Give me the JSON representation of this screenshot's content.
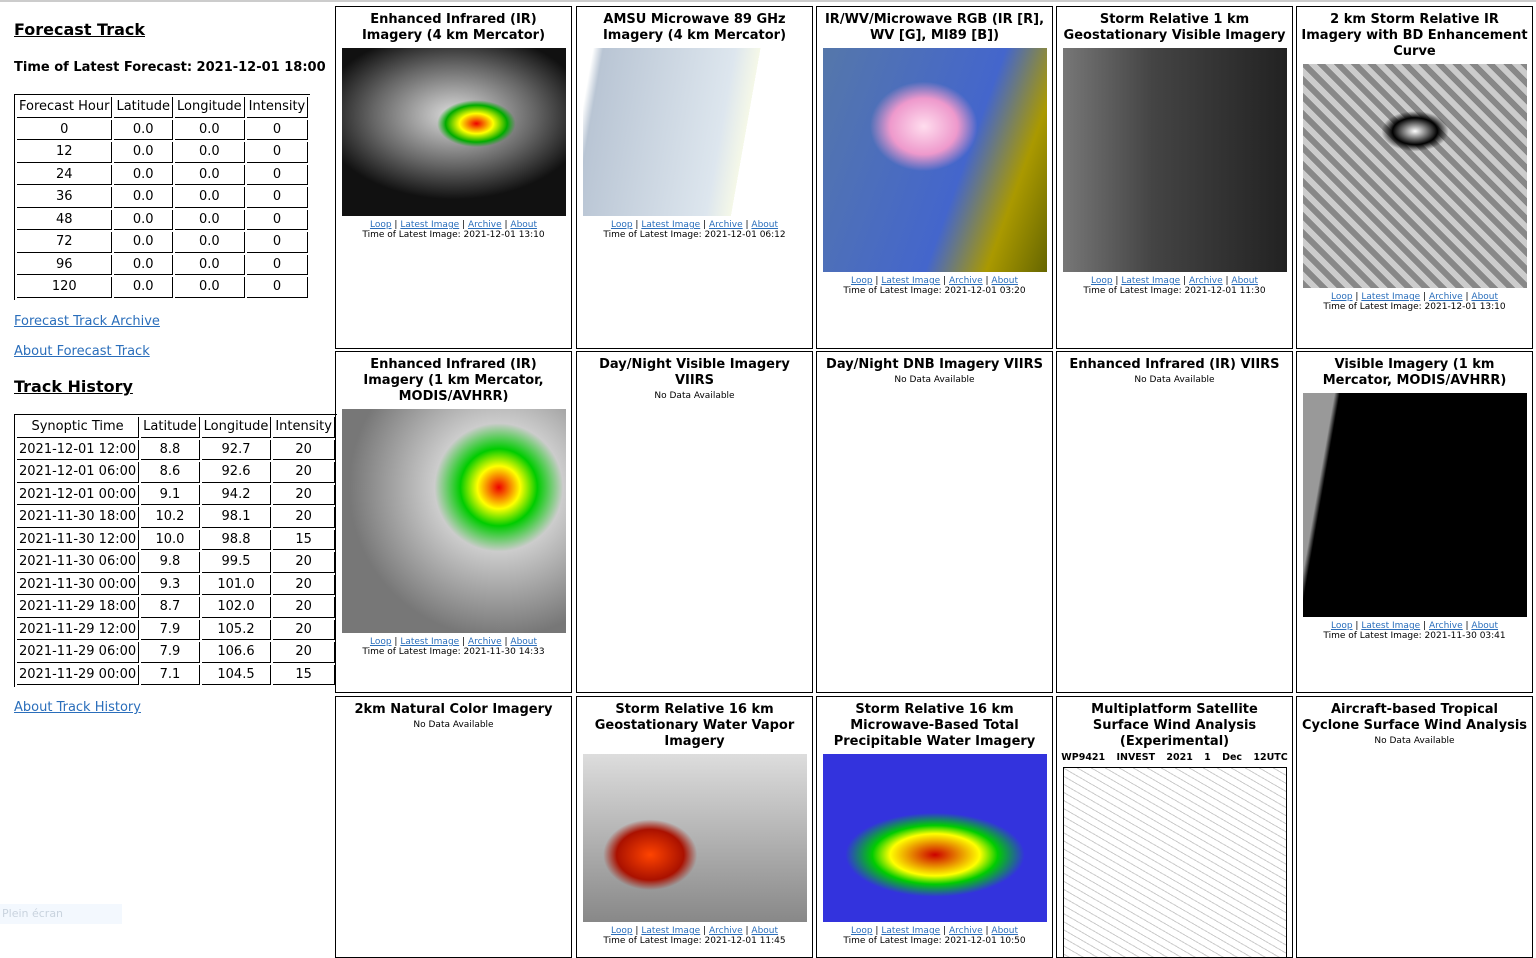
{
  "forecast": {
    "title": "Forecast Track",
    "latest": "Time of Latest Forecast: 2021-12-01 18:00",
    "headers": [
      "Forecast Hour",
      "Latitude",
      "Longitude",
      "Intensity"
    ],
    "rows": [
      [
        "0",
        "0.0",
        "0.0",
        "0"
      ],
      [
        "12",
        "0.0",
        "0.0",
        "0"
      ],
      [
        "24",
        "0.0",
        "0.0",
        "0"
      ],
      [
        "36",
        "0.0",
        "0.0",
        "0"
      ],
      [
        "48",
        "0.0",
        "0.0",
        "0"
      ],
      [
        "72",
        "0.0",
        "0.0",
        "0"
      ],
      [
        "96",
        "0.0",
        "0.0",
        "0"
      ],
      [
        "120",
        "0.0",
        "0.0",
        "0"
      ]
    ],
    "archive_link": "Forecast Track Archive",
    "about_link": "About Forecast Track"
  },
  "history": {
    "title": "Track History",
    "headers": [
      "Synoptic Time",
      "Latitude",
      "Longitude",
      "Intensity"
    ],
    "rows": [
      [
        "2021-12-01 12:00",
        "8.8",
        "92.7",
        "20"
      ],
      [
        "2021-12-01 06:00",
        "8.6",
        "92.6",
        "20"
      ],
      [
        "2021-12-01 00:00",
        "9.1",
        "94.2",
        "20"
      ],
      [
        "2021-11-30 18:00",
        "10.2",
        "98.1",
        "20"
      ],
      [
        "2021-11-30 12:00",
        "10.0",
        "98.8",
        "15"
      ],
      [
        "2021-11-30 06:00",
        "9.8",
        "99.5",
        "20"
      ],
      [
        "2021-11-30 00:00",
        "9.3",
        "101.0",
        "20"
      ],
      [
        "2021-11-29 18:00",
        "8.7",
        "102.0",
        "20"
      ],
      [
        "2021-11-29 12:00",
        "7.9",
        "105.2",
        "20"
      ],
      [
        "2021-11-29 06:00",
        "7.9",
        "106.6",
        "20"
      ],
      [
        "2021-11-29 00:00",
        "7.1",
        "104.5",
        "15"
      ]
    ],
    "about_link": "About Track History"
  },
  "fullscreen": "Plein écran",
  "link_labels": [
    "Loop",
    "Latest Image",
    "Archive",
    "About"
  ],
  "no_data": "No Data Available",
  "panels": [
    {
      "title": "Enhanced Infrared (IR) Imagery (4 km Mercator)",
      "time": "Time of Latest Image: 2021-12-01 13:10",
      "img": "ir4",
      "h": 168
    },
    {
      "title": "AMSU Microwave 89 GHz Imagery (4 km Mercator)",
      "time": "Time of Latest Image: 2021-12-01 06:12",
      "img": "amsu",
      "h": 168
    },
    {
      "title": "IR/WV/Microwave RGB (IR [R], WV [G], MI89 [B])",
      "time": "Time of Latest Image: 2021-12-01 03:20",
      "img": "rgb",
      "h": 224
    },
    {
      "title": "Storm Relative 1 km Geostationary Visible Imagery",
      "time": "Time of Latest Image: 2021-12-01 11:30",
      "img": "vis",
      "h": 224
    },
    {
      "title": "2 km Storm Relative IR Imagery with BD Enhancement Curve",
      "time": "Time of Latest Image: 2021-12-01 13:10",
      "img": "bd",
      "h": 224
    },
    {
      "title": "Enhanced Infrared (IR) Imagery (1 km Mercator, MODIS/AVHRR)",
      "time": "Time of Latest Image: 2021-11-30 14:33",
      "img": "ir1",
      "h": 224
    },
    {
      "title": "Day/Night Visible Imagery VIIRS",
      "time": null
    },
    {
      "title": "Day/Night DNB Imagery VIIRS",
      "time": null
    },
    {
      "title": "Enhanced Infrared (IR) VIIRS",
      "time": null
    },
    {
      "title": "Visible Imagery (1 km Mercator, MODIS/AVHRR)",
      "time": "Time of Latest Image: 2021-11-30 03:41",
      "img": "vis1",
      "h": 224
    },
    {
      "title": "2km Natural Color Imagery",
      "time": null
    },
    {
      "title": "Storm Relative 16 km Geostationary Water Vapor Imagery",
      "time": "Time of Latest Image: 2021-12-01 11:45",
      "img": "wv",
      "h": 168
    },
    {
      "title": "Storm Relative 16 km Microwave-Based Total Precipitable Water Imagery",
      "time": "Time of Latest Image: 2021-12-01 10:50",
      "img": "tpw",
      "h": 168
    },
    {
      "title": "Multiplatform Satellite Surface Wind Analysis (Experimental)",
      "subtitle": "WP9421 INVEST 2021 1 Dec 12UTC",
      "wind": true,
      "img": "wind",
      "h": 220
    },
    {
      "title": "Aircraft-based Tropical Cyclone Surface Wind Analysis",
      "time": null
    }
  ]
}
